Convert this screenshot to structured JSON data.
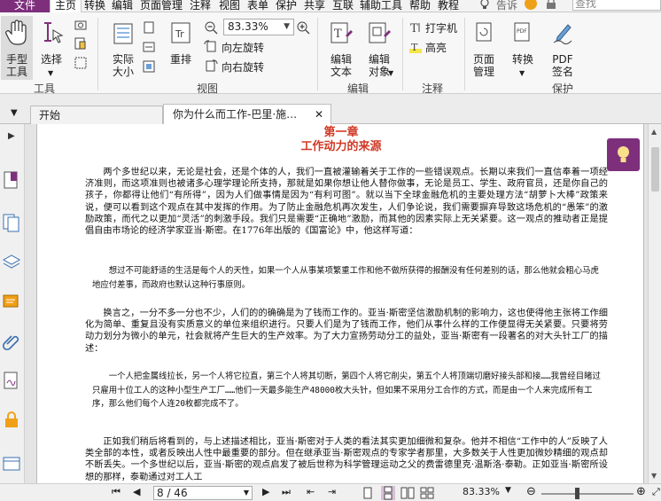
{
  "menu": {
    "items": [
      "文件",
      "主页",
      "转换",
      "编辑",
      "页面管理",
      "注释",
      "视图",
      "表单",
      "保护",
      "共享",
      "互联",
      "辅助工具",
      "帮助",
      "教程"
    ],
    "tell_me": "告诉",
    "search_placeholder": "查找"
  },
  "ribbon": {
    "hand": "手型\n工具",
    "select": "选择",
    "actual_size": "实际\n大小",
    "reflow": "重排",
    "zoom": "83.33%",
    "rotate_left": "向左旋转",
    "rotate_right": "向右旋转",
    "edit_text": "编辑\n文本",
    "edit_object": "编辑\n对象",
    "typewriter": "打字机",
    "highlight": "高亮",
    "page_manage": "页面\n管理",
    "convert": "转换",
    "pdf_sign": "PDF\n签名",
    "groups": {
      "tools": "工具",
      "view": "视图",
      "edit": "编辑",
      "annotate": "注释",
      "protect": "保护"
    }
  },
  "tabs": {
    "start": "开始",
    "doc": "你为什么而工作-巴里·施…",
    "close": "✕"
  },
  "doc": {
    "chapter": "第一章",
    "title": "工作动力的来源",
    "p1": "两个多世纪以来，无论是社会，还是个体的人，我们一直被灌输着关于工作的一些错误观点。长期以来我们一直信奉着一项经济准则，而这项准则也被诸多心理学理论所支持，那就是如果你想让他人替你做事，无论是员工、学生、政府官员，还是你自己的孩子，你都得让他们“有所得”，因为人们做事情是因为“有利可图”。就以当下全球金融危机的主要处理方法“胡萝卜大棒”政策来说，便可以看到这个观点在其中发挥的作用。为了防止金融危机再次发生，人们争论说，我们需要摒弃导致这场危机的“愚笨”的激励政策，而代之以更加“灵活”的刺激手段。我们只是需要“正确地”激励，而其他的因素实际上无关紧要。这一观点的推动者正是提倡自由市场论的经济学家亚当·斯密。在1776年出版的《国富论》中，他这样写道：",
    "q1": "想过不可能舒适的生活是每个人的天性，如果一个人从事某项繁重工作和他不做所获得的报酬没有任何差别的话，那么他就会粗心马虎地应付差事，而政府也默认这种行事原则。",
    "p2": "换言之，一分不多一分也不少，人们的的确确是为了钱而工作的。亚当·斯密坚信激励机制的影响力，这也使得他主张将工作细化为简单、重复且没有实质意义的单位来组织进行。只要人们是为了钱而工作，他们从事什么样的工作便显得无关紧要。只要将劳动力划分为微小的单元，社会就将产生巨大的生产效率。为了大力宣扬劳动分工的益处，亚当·斯密有一段著名的对大头针工厂的描述：",
    "q2": "一个人把金属线拉长，另一个人将它拉直，第三个人将其切断，第四个人将它削尖，第五个人将顶端切磨好接头部和接……我曾经目睹过只雇用十位工人的这种小型生产工厂……他们一天最多能生产48000枚大头针，但如果不采用分工合作的方式，而是由一个人来完成所有工序，那么他们每个人连20枚都完成不了。",
    "p3": "正如我们稍后将看到的，与上述描述相比，亚当·斯密对于人类的看法其实更加细微和复杂。他并不相信“工作中的人”反映了人类全部的本性，或者反映出人性中最重要的部分。但在继承亚当·斯密观点的专家学者那里，大多数关于人性更加微妙精细的观点却不断丢失。一个多世纪以后，亚当·斯密的观点启发了被后世称为科学管理运动之父的费雷德里克·温斯洛·泰勒。正如亚当·斯密所设想的那样，泰勒通过对工人工"
  },
  "status": {
    "page": "8 / 46",
    "zoom": "83.33%",
    "zoom_fraction": 0.38
  }
}
